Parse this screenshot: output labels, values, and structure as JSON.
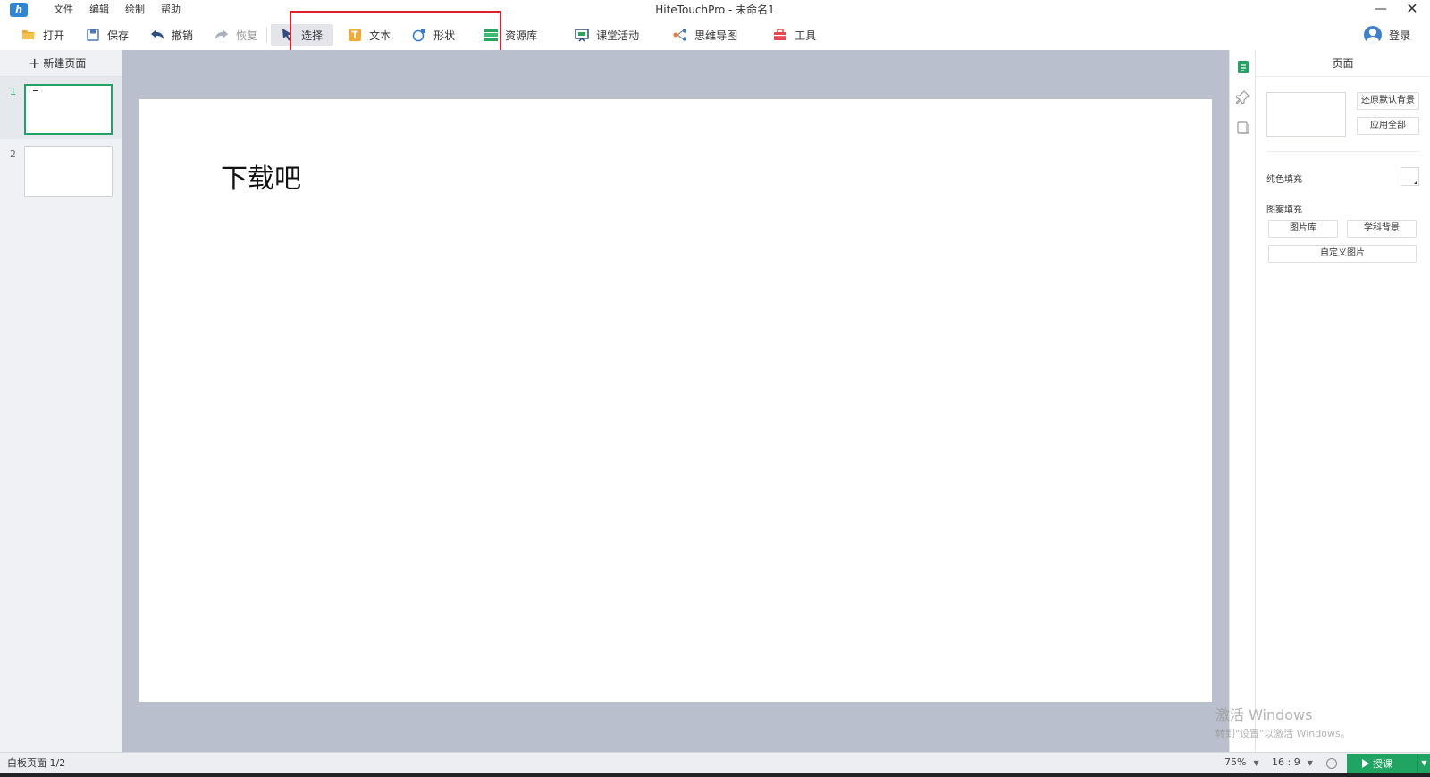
{
  "window": {
    "title": "HiteTouchPro - 未命名1",
    "minimize": "—",
    "close": "✕"
  },
  "menu": [
    "文件",
    "编辑",
    "绘制",
    "帮助"
  ],
  "toolbar": {
    "open": "打开",
    "save": "保存",
    "undo": "撤销",
    "redo": "恢复",
    "select": "选择",
    "text": "文本",
    "shape": "形状",
    "library": "资源库",
    "activity": "课堂活动",
    "mindmap": "思维导图",
    "tools": "工具",
    "login": "登录"
  },
  "pages_panel": {
    "new_page": "新建页面",
    "pages": [
      {
        "number": "1",
        "selected": true
      },
      {
        "number": "2",
        "selected": false
      }
    ]
  },
  "slide": {
    "text": "下载吧"
  },
  "properties": {
    "title": "页面",
    "restore_bg": "还原默认背景",
    "apply_all": "应用全部",
    "solid_fill": "纯色填充",
    "pattern_fill": "图案填充",
    "gallery": "图片库",
    "subject_bg": "学科背景",
    "custom_image": "自定义图片"
  },
  "watermark": {
    "line1": "激活 Windows",
    "line2": "转到\"设置\"以激活 Windows。"
  },
  "status": {
    "page_info": "白板页面 1/2",
    "zoom": "75%",
    "ratio": "16 : 9",
    "teach": "授课"
  },
  "colors": {
    "accent_green": "#1fa462",
    "highlight_red": "#e0202a",
    "canvas_bg": "#b9bfcc"
  }
}
